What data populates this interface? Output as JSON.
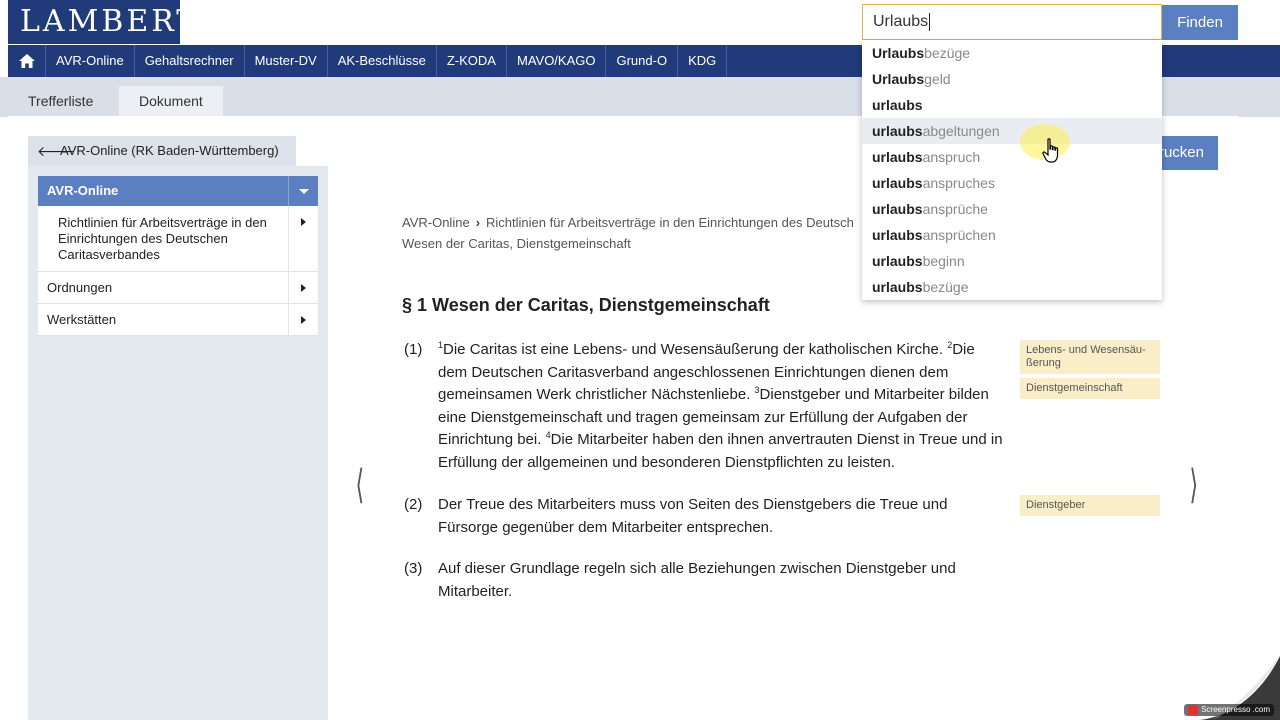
{
  "logo": {
    "text": "LAMBERTUS"
  },
  "search": {
    "value": "Urlaubs",
    "button_label": "Finden"
  },
  "nav": {
    "home_icon": "home-icon",
    "items": [
      "AVR-Online",
      "Gehaltsrechner",
      "Muster-DV",
      "AK-Beschlüsse",
      "Z-KODA",
      "MAVO/KAGO",
      "Grund-O",
      "KDG"
    ]
  },
  "tabs": [
    {
      "label": "Trefferliste",
      "active": false
    },
    {
      "label": "Dokument",
      "active": true
    }
  ],
  "back": {
    "label": "AVR-Online (RK Baden-Württemberg)"
  },
  "sidebar": {
    "head": "AVR-Online",
    "sub_item": "Richtlinien für Arbeitsverträge in den Einrichtungen des Deutschen Caritasverbandes",
    "items": [
      "Ordnungen",
      "Werkstätten"
    ]
  },
  "print_label": "rucken",
  "breadcrumb": {
    "root": "AVR-Online",
    "line1": "Richtlinien für Arbeitsverträge in den Einrichtungen des Deutsch",
    "line2": "Wesen der Caritas, Dienstgemeinschaft"
  },
  "doc": {
    "title": "§ 1 Wesen der Caritas, Dienstgemeinschaft",
    "p1": {
      "num": "(1)",
      "s1": "Die Caritas ist eine Lebens- und Wesensäußerung der katholischen Kirche. ",
      "s2": "Die dem Deutschen Caritasverband angeschlossenen Einrichtungen dienen dem gemeinsamen Werk christlicher Nächstenliebe. ",
      "s3": "Dienstgeber und Mitarbeiter bilden eine Dienstgemeinschaft und tragen gemeinsam zur Erfüllung der Aufgaben der Einrichtung bei. ",
      "s4": "Die Mitarbeiter haben den ihnen anvertrauten Dienst in Treue und in Erfüllung der allgemeinen und besonderen Dienstpflichten zu leisten.",
      "sup1": "1",
      "sup2": "2",
      "sup3": "3",
      "sup4": "4"
    },
    "p2": {
      "num": "(2)",
      "text": "Der Treue des Mitarbeiters muss von Seiten des Dienstgebers die Treue und Fürsorge gegenüber dem Mitarbeiter entsprechen."
    },
    "p3": {
      "num": "(3)",
      "text": "Auf dieser Grundlage regeln sich alle Beziehungen zwischen Dienstgeber und Mitarbeiter."
    }
  },
  "tags": {
    "t1": "Lebens- und Wesensäu-ßerung",
    "t2": "Dienstgemeinschaft",
    "t3": "Dienstgeber"
  },
  "arrows": {
    "prev": "⟨",
    "next": "⟩"
  },
  "suggestions": [
    {
      "bold": "Urlaubs",
      "rest": "bezüge"
    },
    {
      "bold": "Urlaubs",
      "rest": "geld"
    },
    {
      "bold": "urlaubs",
      "rest": ""
    },
    {
      "bold": "urlaubs",
      "rest": "abgeltungen"
    },
    {
      "bold": "urlaubs",
      "rest": "anspruch"
    },
    {
      "bold": "urlaubs",
      "rest": "anspruches"
    },
    {
      "bold": "urlaubs",
      "rest": "ansprüche"
    },
    {
      "bold": "urlaubs",
      "rest": "ansprüchen"
    },
    {
      "bold": "urlaubs",
      "rest": "beginn"
    },
    {
      "bold": "urlaubs",
      "rest": "bezüge"
    }
  ],
  "watermark": "Screenpresso .com",
  "colors": {
    "navy": "#213a7a",
    "accent": "#5b7fc0",
    "tag_bg": "#faeec8",
    "search_border": "#e0b24a"
  }
}
